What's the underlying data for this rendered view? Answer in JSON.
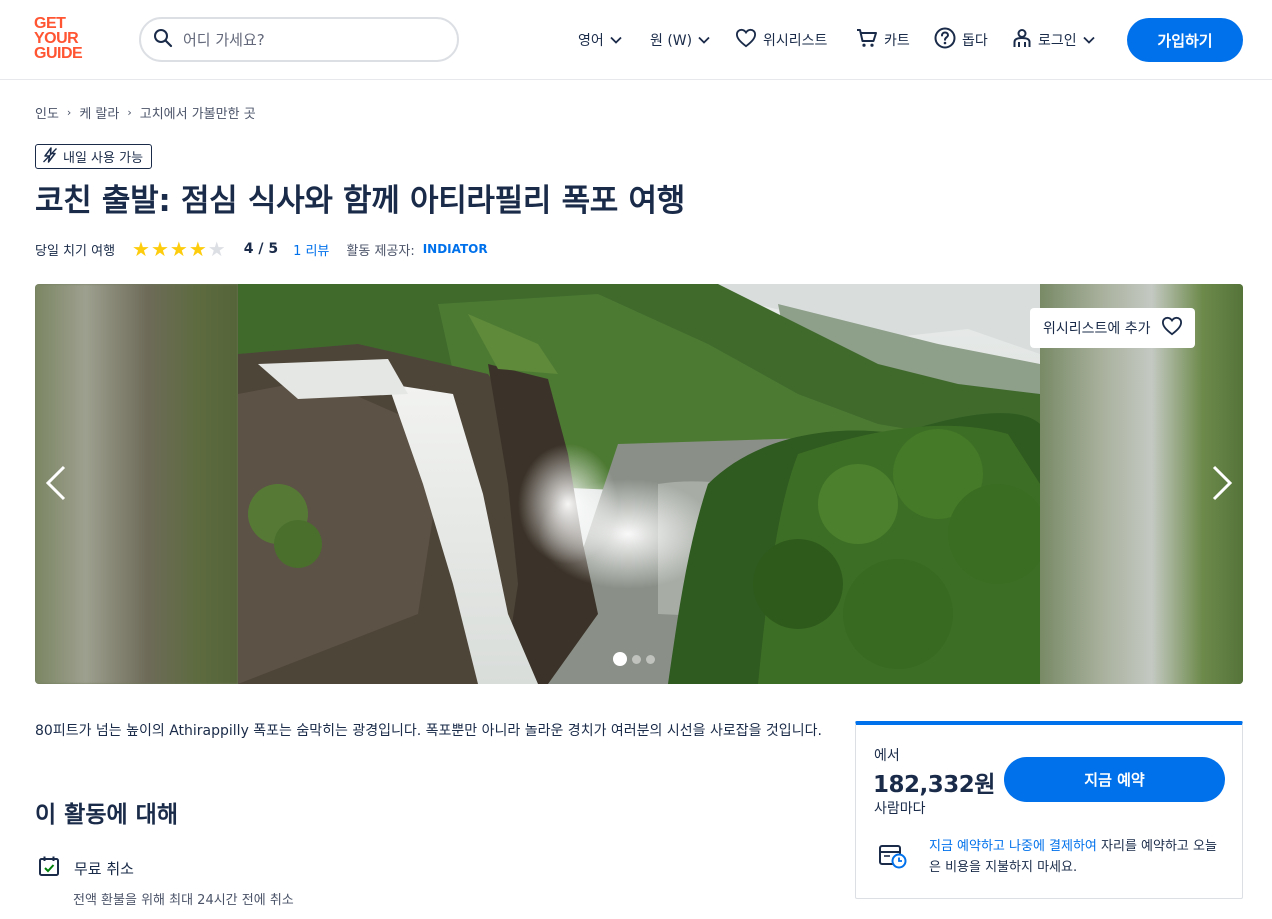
{
  "header": {
    "logo_lines": [
      "GET",
      "YOUR",
      "GUIDE"
    ],
    "search_placeholder": "어디 가세요?",
    "language_label": "영어",
    "currency_label": "원 (W)",
    "wishlist_label": "위시리스트",
    "cart_label": "카트",
    "help_label": "돕다",
    "login_label": "로그인",
    "signup_label": "가입하기"
  },
  "breadcrumb": [
    "인도",
    "케 랄라",
    "고치에서 가볼만한 곳"
  ],
  "badge": {
    "label": "내일 사용 가능"
  },
  "title": "코친 출발: 점심 식사와 함께 아티라필리 폭포 여행",
  "meta": {
    "category": "당일 치기 여행",
    "stars_filled": 4,
    "stars_total": 5,
    "rating_text": "4 / 5",
    "reviews_text": "1 리뷰",
    "provider_label": "활동 제공자:",
    "provider_name": "INDIATOR"
  },
  "gallery": {
    "wishlist_add_label": "위시리스트에 추가",
    "slide_count": 3,
    "active_slide": 1
  },
  "description": "80피트가 넘는 높이의 Athirappilly 폭포는 숨막히는 광경입니다. 폭포뿐만 아니라 놀라운 경치가 여러분의 시선을 사로잡을 것입니다.",
  "about": {
    "heading": "이 활동에 대해",
    "features": [
      {
        "title": "무료 취소",
        "subtitle": "전액 환불을 위해 최대 24시간 전에 취소"
      }
    ]
  },
  "booking": {
    "from_label": "에서",
    "price": "182,332원",
    "per_label": "사람마다",
    "book_button": "지금 예약",
    "note_link": "지금 예약하고 나중에 결제하여",
    "note_rest": " 자리를 예약하고 오늘은 비용을 지불하지 마세요."
  },
  "colors": {
    "brand_orange": "#ff5533",
    "primary_blue": "#0071eb",
    "text_dark": "#1a2b49",
    "star_yellow": "#fdcc0d",
    "star_empty": "#dcdfe4"
  }
}
